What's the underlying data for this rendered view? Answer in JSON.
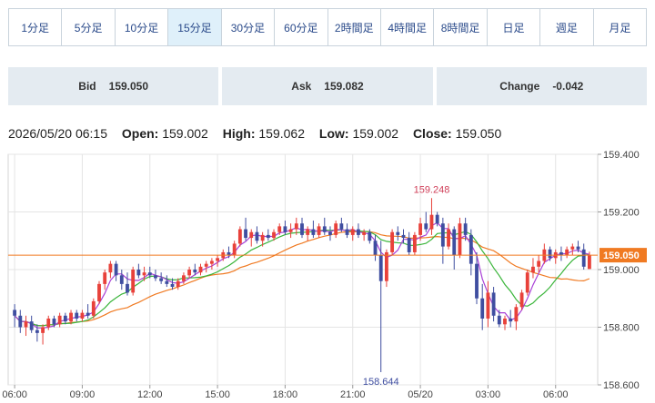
{
  "tabs": [
    {
      "label": "1分足",
      "active": false
    },
    {
      "label": "5分足",
      "active": false
    },
    {
      "label": "10分足",
      "active": false
    },
    {
      "label": "15分足",
      "active": true
    },
    {
      "label": "30分足",
      "active": false
    },
    {
      "label": "60分足",
      "active": false
    },
    {
      "label": "2時間足",
      "active": false
    },
    {
      "label": "4時間足",
      "active": false
    },
    {
      "label": "8時間足",
      "active": false
    },
    {
      "label": "日足",
      "active": false
    },
    {
      "label": "週足",
      "active": false
    },
    {
      "label": "月足",
      "active": false
    }
  ],
  "quote": {
    "bid_label": "Bid",
    "bid": "159.050",
    "ask_label": "Ask",
    "ask": "159.082",
    "change_label": "Change",
    "change": "-0.042"
  },
  "ohlc": {
    "datetime": "2026/05/20 06:15",
    "open_label": "Open:",
    "open": "159.002",
    "high_label": "High:",
    "high": "159.062",
    "low_label": "Low:",
    "low": "159.002",
    "close_label": "Close:",
    "close": "159.050"
  },
  "colors": {
    "up": "#e8413a",
    "down": "#3f4ea0",
    "ma_short": "#a83fd6",
    "ma_mid": "#3ab53a",
    "ma_long": "#f07a22",
    "current_price": "#f07a22",
    "grid": "#e4e4e4"
  },
  "chart_data": {
    "type": "candlestick",
    "ylim": [
      158.6,
      159.4
    ],
    "y_ticks": [
      "159.400",
      "159.200",
      "159.000",
      "158.800",
      "158.600"
    ],
    "x_ticks": [
      "06:00",
      "09:00",
      "12:00",
      "15:00",
      "18:00",
      "21:00",
      "05/20",
      "03:00",
      "06:00"
    ],
    "current_price": "159.050",
    "annotations": [
      {
        "text": "159.248",
        "value": 159.248,
        "at_candle": 74
      },
      {
        "text": "158.644",
        "value": 158.644,
        "at_candle": 65
      }
    ],
    "candles": [
      [
        158.86,
        158.88,
        158.8,
        158.84
      ],
      [
        158.84,
        158.86,
        158.78,
        158.8
      ],
      [
        158.8,
        158.84,
        158.77,
        158.82
      ],
      [
        158.82,
        158.84,
        158.78,
        158.79
      ],
      [
        158.79,
        158.81,
        158.75,
        158.78
      ],
      [
        158.78,
        158.81,
        158.74,
        158.8
      ],
      [
        158.8,
        158.84,
        158.79,
        158.83
      ],
      [
        158.83,
        158.84,
        158.8,
        158.81
      ],
      [
        158.81,
        158.85,
        158.8,
        158.84
      ],
      [
        158.84,
        158.85,
        158.81,
        158.82
      ],
      [
        158.82,
        158.86,
        158.81,
        158.85
      ],
      [
        158.85,
        158.86,
        158.82,
        158.83
      ],
      [
        158.83,
        158.86,
        158.82,
        158.85
      ],
      [
        158.85,
        158.88,
        158.83,
        158.84
      ],
      [
        158.84,
        158.9,
        158.83,
        158.89
      ],
      [
        158.89,
        158.96,
        158.88,
        158.95
      ],
      [
        158.95,
        159.0,
        158.93,
        158.99
      ],
      [
        158.99,
        159.03,
        158.97,
        159.02
      ],
      [
        159.02,
        159.03,
        158.96,
        158.98
      ],
      [
        158.98,
        159.0,
        158.93,
        158.95
      ],
      [
        158.95,
        158.99,
        158.91,
        158.92
      ],
      [
        158.92,
        159.01,
        158.91,
        159.0
      ],
      [
        159.0,
        159.02,
        158.97,
        158.98
      ],
      [
        158.98,
        159.01,
        158.96,
        158.99
      ],
      [
        158.99,
        159.01,
        158.97,
        158.98
      ],
      [
        158.98,
        159.0,
        158.96,
        158.97
      ],
      [
        158.97,
        158.99,
        158.95,
        158.96
      ],
      [
        158.96,
        158.98,
        158.94,
        158.95
      ],
      [
        158.95,
        158.97,
        158.93,
        158.94
      ],
      [
        158.94,
        158.97,
        158.93,
        158.96
      ],
      [
        158.96,
        158.99,
        158.95,
        158.98
      ],
      [
        158.98,
        159.01,
        158.97,
        159.0
      ],
      [
        159.0,
        159.02,
        158.98,
        158.99
      ],
      [
        158.99,
        159.02,
        158.98,
        159.01
      ],
      [
        159.01,
        159.03,
        158.99,
        159.02
      ],
      [
        159.02,
        159.04,
        159.0,
        159.03
      ],
      [
        159.03,
        159.05,
        159.01,
        159.04
      ],
      [
        159.04,
        159.07,
        159.03,
        159.06
      ],
      [
        159.06,
        159.08,
        159.04,
        159.05
      ],
      [
        159.05,
        159.1,
        159.04,
        159.09
      ],
      [
        159.09,
        159.15,
        159.08,
        159.14
      ],
      [
        159.14,
        159.18,
        159.1,
        159.11
      ],
      [
        159.11,
        159.14,
        159.08,
        159.13
      ],
      [
        159.13,
        159.15,
        159.09,
        159.1
      ],
      [
        159.1,
        159.13,
        159.08,
        159.12
      ],
      [
        159.12,
        159.14,
        159.1,
        159.11
      ],
      [
        159.11,
        159.14,
        159.1,
        159.13
      ],
      [
        159.13,
        159.16,
        159.12,
        159.15
      ],
      [
        159.15,
        159.17,
        159.12,
        159.13
      ],
      [
        159.13,
        159.16,
        159.11,
        159.14
      ],
      [
        159.14,
        159.18,
        159.12,
        159.16
      ],
      [
        159.16,
        159.18,
        159.11,
        159.12
      ],
      [
        159.12,
        159.15,
        159.1,
        159.14
      ],
      [
        159.14,
        159.17,
        159.11,
        159.12
      ],
      [
        159.12,
        159.16,
        159.11,
        159.15
      ],
      [
        159.15,
        159.18,
        159.12,
        159.13
      ],
      [
        159.13,
        159.15,
        159.1,
        159.12
      ],
      [
        159.12,
        159.17,
        159.11,
        159.16
      ],
      [
        159.16,
        159.18,
        159.13,
        159.14
      ],
      [
        159.14,
        159.16,
        159.11,
        159.12
      ],
      [
        159.12,
        159.15,
        159.1,
        159.14
      ],
      [
        159.14,
        159.16,
        159.11,
        159.12
      ],
      [
        159.12,
        159.14,
        159.1,
        159.13
      ],
      [
        159.13,
        159.14,
        159.09,
        159.1
      ],
      [
        159.1,
        159.12,
        159.03,
        159.05
      ],
      [
        159.05,
        159.1,
        158.644,
        158.96
      ],
      [
        158.96,
        159.07,
        158.94,
        159.06
      ],
      [
        159.06,
        159.14,
        159.05,
        159.13
      ],
      [
        159.13,
        159.15,
        159.1,
        159.12
      ],
      [
        159.12,
        159.14,
        159.09,
        159.11
      ],
      [
        159.11,
        159.13,
        159.05,
        159.06
      ],
      [
        159.06,
        159.13,
        159.05,
        159.12
      ],
      [
        159.12,
        159.18,
        159.1,
        159.16
      ],
      [
        159.16,
        159.2,
        159.13,
        159.14
      ],
      [
        159.14,
        159.248,
        159.12,
        159.19
      ],
      [
        159.19,
        159.2,
        159.15,
        159.16
      ],
      [
        159.16,
        159.18,
        159.02,
        159.08
      ],
      [
        159.08,
        159.16,
        159.07,
        159.14
      ],
      [
        159.14,
        159.15,
        159.0,
        159.05
      ],
      [
        159.05,
        159.18,
        159.04,
        159.16
      ],
      [
        159.16,
        159.18,
        159.1,
        159.12
      ],
      [
        159.12,
        159.14,
        158.98,
        159.02
      ],
      [
        159.02,
        159.06,
        158.88,
        158.9
      ],
      [
        158.9,
        158.95,
        158.79,
        158.83
      ],
      [
        158.83,
        158.96,
        158.8,
        158.92
      ],
      [
        158.92,
        158.94,
        158.82,
        158.84
      ],
      [
        158.84,
        158.86,
        158.8,
        158.81
      ],
      [
        158.81,
        158.84,
        158.79,
        158.83
      ],
      [
        158.83,
        158.86,
        158.8,
        158.82
      ],
      [
        158.82,
        158.88,
        158.79,
        158.87
      ],
      [
        158.87,
        158.93,
        158.86,
        158.92
      ],
      [
        158.92,
        159.0,
        158.91,
        158.99
      ],
      [
        158.99,
        159.04,
        158.97,
        159.01
      ],
      [
        159.01,
        159.05,
        158.99,
        159.03
      ],
      [
        159.03,
        159.09,
        159.02,
        159.07
      ],
      [
        159.07,
        159.08,
        159.03,
        159.04
      ],
      [
        159.04,
        159.07,
        159.02,
        159.06
      ],
      [
        159.06,
        159.08,
        159.03,
        159.05
      ],
      [
        159.05,
        159.08,
        159.04,
        159.07
      ],
      [
        159.07,
        159.09,
        159.05,
        159.08
      ],
      [
        159.08,
        159.1,
        159.06,
        159.07
      ],
      [
        159.07,
        159.09,
        159.0,
        159.01
      ],
      [
        159.002,
        159.062,
        159.002,
        159.05
      ]
    ]
  }
}
